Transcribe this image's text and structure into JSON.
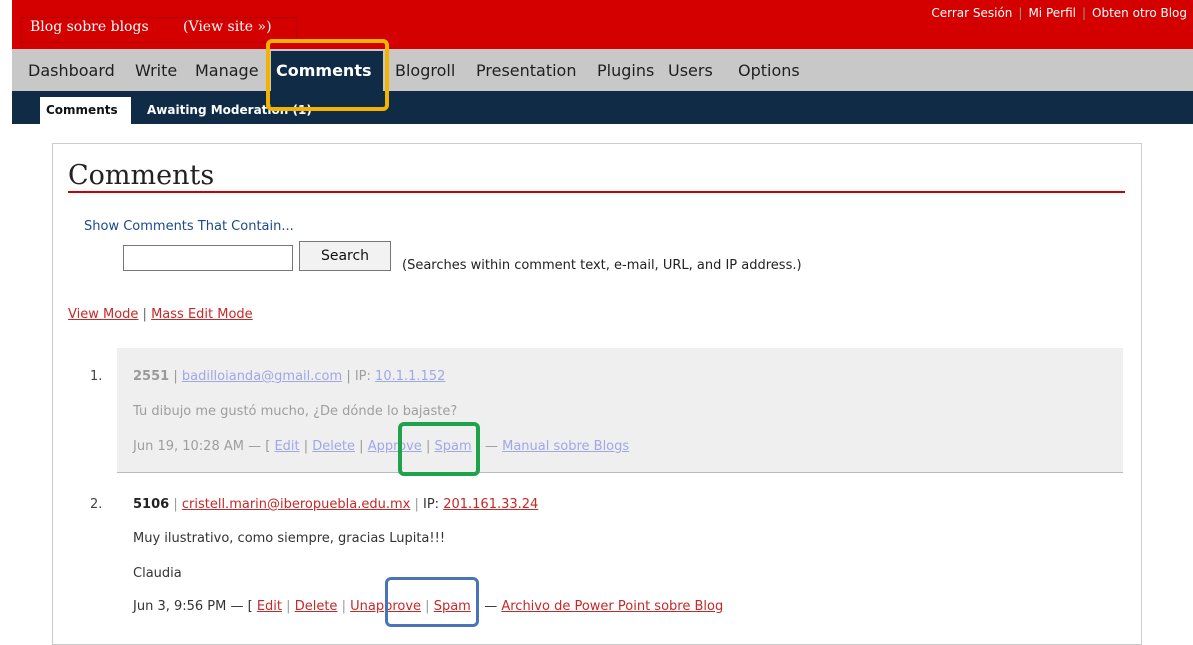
{
  "header": {
    "blog_name": "Blog sobre blogs",
    "view_site": "(View site »)",
    "logout": "Cerrar Sesión",
    "profile": "Mi Perfil",
    "other_blog": "Obten otro Blog",
    "separator": "|"
  },
  "nav": {
    "items": [
      "Dashboard",
      "Write",
      "Manage",
      "Comments",
      "Blogroll",
      "Presentation",
      "Plugins",
      "Users",
      "Options"
    ],
    "active": "Comments"
  },
  "subnav": {
    "comments": "Comments",
    "awaiting": "Awaiting Moderation (1)"
  },
  "page": {
    "title": "Comments",
    "search_heading": "Show Comments That Contain...",
    "search_value": "",
    "search_button": "Search",
    "search_hint": "(Searches within comment text, e-mail, URL, and IP address.)",
    "view_mode": "View Mode",
    "mass_edit_mode": "Mass Edit Mode",
    "pipe": "|"
  },
  "comments": [
    {
      "num": "1.",
      "author": "2551",
      "email": "badilloianda@gmail.com",
      "ip_label": "IP:",
      "ip": "10.1.1.152",
      "text": "Tu dibujo me gustó mucho, ¿De dónde lo bajaste?",
      "date": "Jun 19, 10:28 AM — [",
      "actions": [
        "Edit",
        "Delete",
        "Approve",
        "Spam"
      ],
      "close": "] —",
      "post": "Manual sobre Blogs",
      "status": "pending"
    },
    {
      "num": "2.",
      "author": "5106",
      "email": "cristell.marin@iberopuebla.edu.mx",
      "ip_label": "IP:",
      "ip": "201.161.33.24",
      "text": "Muy ilustrativo, como siempre, gracias Lupita!!!",
      "signature": "Claudia",
      "date": "Jun 3, 9:56 PM — [",
      "actions": [
        "Edit",
        "Delete",
        "Unapprove",
        "Spam"
      ],
      "close": "] —",
      "post": "Archivo de Power Point sobre Blog",
      "status": "approved"
    }
  ],
  "colors": {
    "header_red": "#d40000",
    "nav_gray": "#c8c8c8",
    "subnav_navy": "#0f2b46",
    "link_red": "#c62828",
    "highlight_yellow": "#f5b301",
    "highlight_green": "#1fa34a",
    "highlight_blue": "#4a74b8"
  }
}
